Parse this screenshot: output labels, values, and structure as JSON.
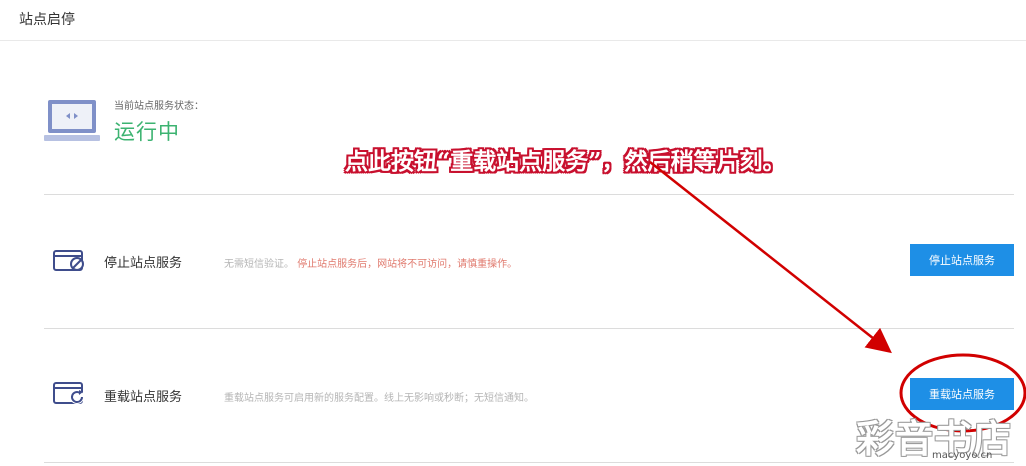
{
  "header": {
    "title": "站点启停"
  },
  "status": {
    "label": "当前站点服务状态：",
    "value": "运行中",
    "color": "#3cb371"
  },
  "rows": [
    {
      "title": "停止站点服务",
      "desc_plain": "无需短信验证。",
      "desc_warning": "停止站点服务后，网站将不可访问，请慎重操作。",
      "button": "停止站点服务",
      "icon": "stop-site-icon"
    },
    {
      "title": "重载站点服务",
      "desc_plain": "重载站点服务可启用新的服务配置。线上无影响或秒断；无短信通知。",
      "button": "重载站点服务",
      "icon": "reload-site-icon"
    }
  ],
  "annotation": {
    "text": "点此按钮“重载站点服务”，然后稍等片刻。",
    "color": "#c8102e"
  },
  "watermark": {
    "big": "彩音书店",
    "small": "macyoyo.cn"
  },
  "colors": {
    "accent": "#1e8fe6",
    "warning": "#e07a6e",
    "success": "#3cb371"
  }
}
